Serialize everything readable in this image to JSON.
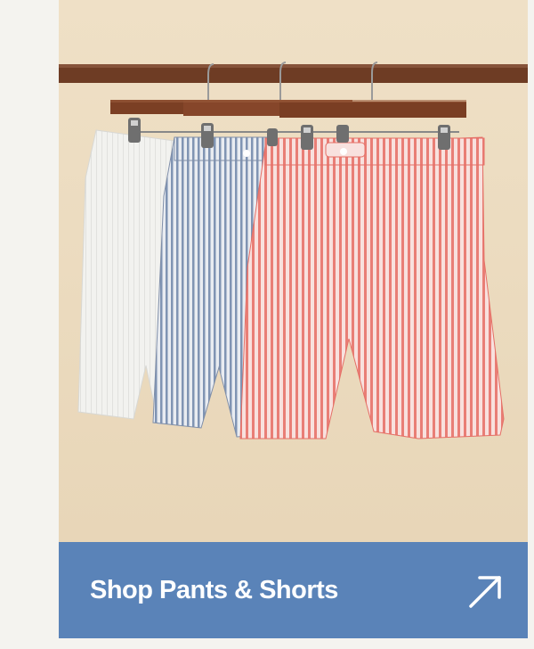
{
  "promo": {
    "cta_label": "Shop Pants & Shorts",
    "icons": {
      "cta": "arrow-up-right-icon"
    },
    "colors": {
      "background": "#ecdcc1",
      "cta": "#5a83b8",
      "cta_text": "#ffffff",
      "rail": "#6e3c24",
      "shorts": [
        "#f2f2ef",
        "#8c9bb4",
        "#e97e76"
      ]
    }
  }
}
